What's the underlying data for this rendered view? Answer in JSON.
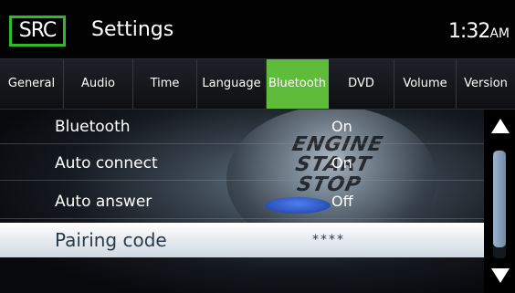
{
  "header": {
    "source_button": "SRC",
    "title": "Settings",
    "clock_time": "1:32",
    "clock_ampm": "AM"
  },
  "tabs": [
    {
      "label": "General",
      "active": false
    },
    {
      "label": "Audio",
      "active": false
    },
    {
      "label": "Time",
      "active": false
    },
    {
      "label": "Language",
      "active": false
    },
    {
      "label": "Bluetooth",
      "active": true
    },
    {
      "label": "DVD",
      "active": false
    },
    {
      "label": "Volume",
      "active": false
    },
    {
      "label": "Version",
      "active": false
    }
  ],
  "settings": [
    {
      "label": "Bluetooth",
      "value": "On"
    },
    {
      "label": "Auto connect",
      "value": "On"
    },
    {
      "label": "Auto answer",
      "value": "Off"
    },
    {
      "label": "Pairing code",
      "value": "****",
      "selected": true
    }
  ],
  "background": {
    "engine_button_text": [
      "ENGINE",
      "START",
      "STOP"
    ]
  },
  "colors": {
    "accent": "#5fbc3a",
    "src_border": "#33b82a",
    "selected_row_text": "#2b3a4a",
    "scroll_thumb": "#6f8aa8"
  },
  "scroll": {
    "position_fraction": 0.0,
    "visible_fraction": 0.9
  }
}
